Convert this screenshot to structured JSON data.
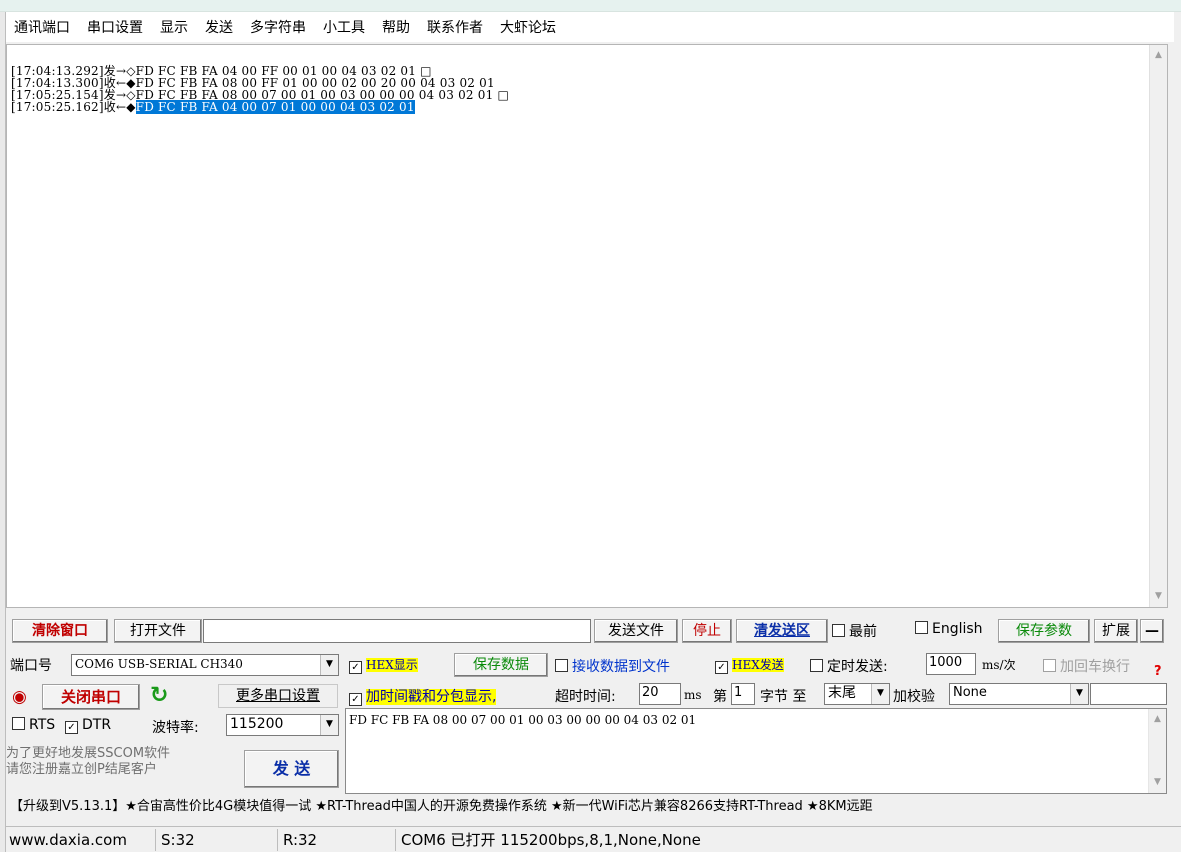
{
  "menu": [
    "通讯端口",
    "串口设置",
    "显示",
    "发送",
    "多字符串",
    "小工具",
    "帮助",
    "联系作者",
    "大虾论坛"
  ],
  "receive_log": [
    {
      "prefix": "[17:04:13.292]发→◇",
      "data": "FD FC FB FA 04 00 FF 00 01 00 04 03 02 01 □",
      "selected": false
    },
    {
      "prefix": "[17:04:13.300]收←◆",
      "data": "FD FC FB FA 08 00 FF 01 00 00 02 00 20 00 04 03 02 01",
      "selected": false
    },
    {
      "prefix": "[17:05:25.154]发→◇",
      "data": "FD FC FB FA 08 00 07 00 01 00 03 00 00 00 04 03 02 01 □",
      "selected": false
    },
    {
      "prefix": "[17:05:25.162]收←◆",
      "data": "FD FC FB FA 04 00 07 01 00 00 04 03 02 01",
      "selected": true
    }
  ],
  "toolbar": {
    "clear_window": "清除窗口",
    "open_file": "打开文件",
    "file_path": "",
    "send_file": "发送文件",
    "stop": "停止",
    "clear_send": "清发送区",
    "topmost": "最前",
    "english": "English",
    "save_params": "保存参数",
    "expand": "扩展",
    "minus": "—"
  },
  "port": {
    "label": "端口号",
    "value": "COM6 USB-SERIAL CH340",
    "close_port": "关闭串口",
    "more_settings": "更多串口设置",
    "rts": "RTS",
    "rts_checked": false,
    "dtr": "DTR",
    "dtr_checked": true,
    "baud_label": "波特率:",
    "baud_value": "115200"
  },
  "options": {
    "hex_display": "HEX显示",
    "hex_display_checked": true,
    "save_data": "保存数据",
    "recv_to_file": "接收数据到文件",
    "recv_to_file_checked": false,
    "hex_send": "HEX发送",
    "hex_send_checked": true,
    "timed_send": "定时发送:",
    "timed_send_checked": false,
    "interval": "1000",
    "interval_unit": "ms/次",
    "add_crlf": "加回车换行",
    "add_crlf_checked": false,
    "timestamp": "加时间戳和分包显示,",
    "timestamp_checked": true,
    "timeout_label": "超时时间:",
    "timeout_value": "20",
    "timeout_unit": "ms",
    "byte_label": "第",
    "byte_value": "1",
    "byte_unit": "字节 至",
    "end_value": "末尾",
    "checksum_label": "加校验",
    "checksum_value": "None"
  },
  "promo": "为了更好地发展SSCOM软件\n请您注册嘉立创P结尾客户",
  "send_button": "发 送",
  "send_text": "FD FC FB FA 08 00 07 00 01 00 03 00 00 00 04 03 02 01",
  "ticker": "【升级到V5.13.1】★合宙高性价比4G模块值得一试 ★RT-Thread中国人的开源免费操作系统 ★新一代WiFi芯片兼容8266支持RT-Thread ★8KM远距",
  "status": {
    "site": "www.daxia.com",
    "sent": "S:32",
    "received": "R:32",
    "port_state": "COM6 已打开  115200bps,8,1,None,None"
  },
  "colors": {
    "selection": "#0078d7",
    "highlight": "#ffff00",
    "accent_red": "#c00000"
  }
}
